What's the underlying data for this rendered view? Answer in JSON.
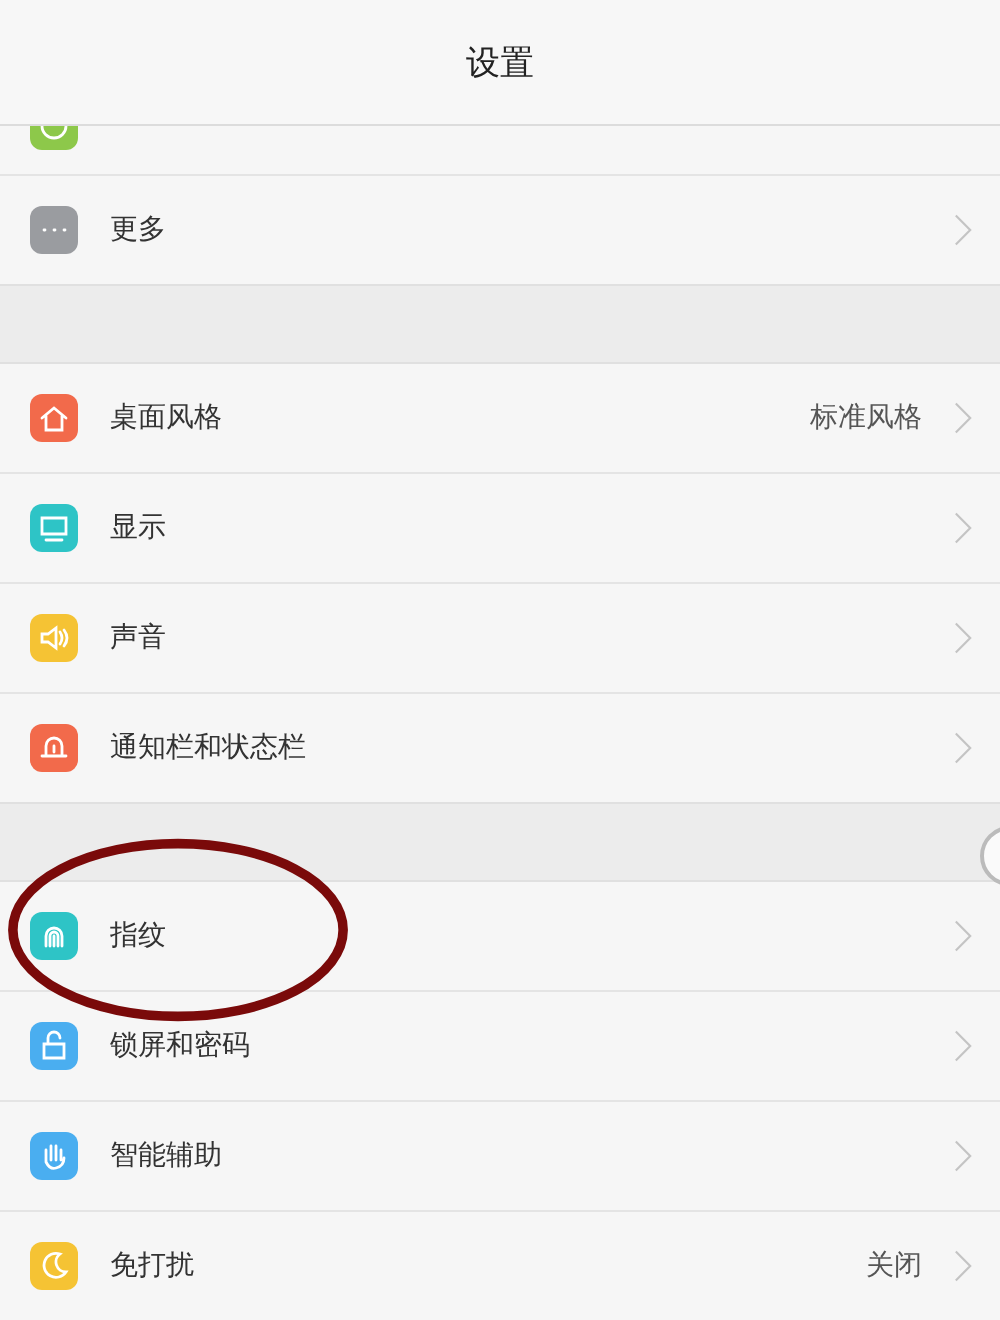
{
  "header": {
    "title": "设置"
  },
  "groups": [
    {
      "items": [
        {
          "color": "#8dc84a",
          "partial": true
        },
        {
          "label": "更多",
          "color": "#9a9ca0"
        }
      ]
    },
    {
      "items": [
        {
          "label": "桌面风格",
          "value": "标准风格",
          "color": "#f26a4b"
        },
        {
          "label": "显示",
          "color": "#2ec4c6"
        },
        {
          "label": "声音",
          "color": "#f5c334"
        },
        {
          "label": "通知栏和状态栏",
          "color": "#f26a4b"
        }
      ]
    },
    {
      "items": [
        {
          "label": "指纹",
          "color": "#2ec4c6"
        },
        {
          "label": "锁屏和密码",
          "color": "#4aaef0"
        },
        {
          "label": "智能辅助",
          "color": "#4aaef0"
        },
        {
          "label": "免打扰",
          "value": "关闭",
          "color": "#f5c334"
        }
      ]
    }
  ]
}
